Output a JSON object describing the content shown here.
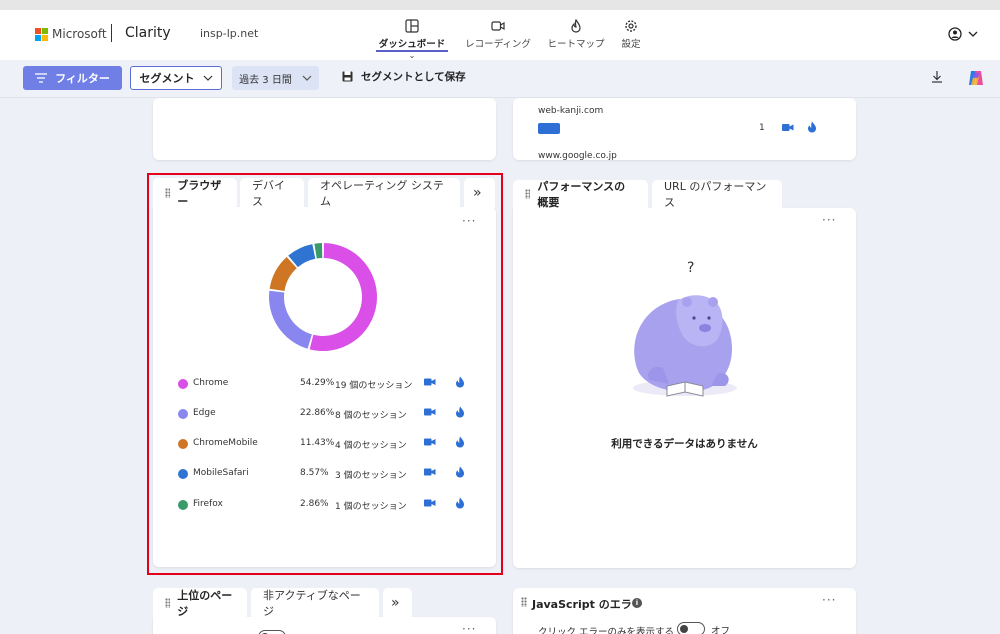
{
  "header": {
    "brand_ms": "Microsoft",
    "brand_product": "Clarity",
    "project": "insp-lp.net",
    "nav": [
      {
        "label": "ダッシュボード",
        "icon": "dashboard-icon",
        "active": true
      },
      {
        "label": "レコーディング",
        "icon": "video-icon"
      },
      {
        "label": "ヒートマップ",
        "icon": "flame-icon"
      },
      {
        "label": "設定",
        "icon": "gear-icon"
      }
    ],
    "user_icon": "account-icon"
  },
  "toolbar": {
    "filter_label": "フィルター",
    "segment_label": "セグメント",
    "range_label": "過去 3 日間",
    "save_label": "セグメントとして保存",
    "download_icon": "download-icon",
    "copilot_icon": "copilot-icon"
  },
  "referrers": {
    "site1": "web-kanji.com",
    "site1_count": "1",
    "site2": "www.google.co.jp"
  },
  "browser_card": {
    "tabs": [
      "ブラウザー",
      "デバイス",
      "オペレーティング システム"
    ],
    "more_tabs": "»",
    "menu": "···",
    "rows": [
      {
        "name": "Chrome",
        "percent": "54.29%",
        "value": 54.29,
        "sessions": "19 個のセッション",
        "color": "#d94fe8"
      },
      {
        "name": "Edge",
        "percent": "22.86%",
        "value": 22.86,
        "sessions": "8 個のセッション",
        "color": "#8a86f0"
      },
      {
        "name": "ChromeMobile",
        "percent": "11.43%",
        "value": 11.43,
        "sessions": "4 個のセッション",
        "color": "#cf7625"
      },
      {
        "name": "MobileSafari",
        "percent": "8.57%",
        "value": 8.57,
        "sessions": "3 個のセッション",
        "color": "#2f74d0"
      },
      {
        "name": "Firefox",
        "percent": "2.86%",
        "value": 2.86,
        "sessions": "1 個のセッション",
        "color": "#3a9b6a"
      }
    ]
  },
  "perf_card": {
    "tabs": [
      "パフォーマンスの概要",
      "URL のパフォーマンス"
    ],
    "menu": "···",
    "question": "?",
    "empty": "利用できるデータはありません"
  },
  "pages_card": {
    "tabs": [
      "上位のページ",
      "非アクティブなページ"
    ],
    "more_tabs": "»",
    "menu": "···"
  },
  "js_card": {
    "title": "JavaScript のエラー",
    "menu": "···",
    "filter_label": "クリック エラーのみを表示する",
    "toggle_state": "オフ"
  },
  "colors": {
    "accent": "#6f7fe6",
    "record": "#2d6fd4",
    "highlight": "#e3001b"
  }
}
